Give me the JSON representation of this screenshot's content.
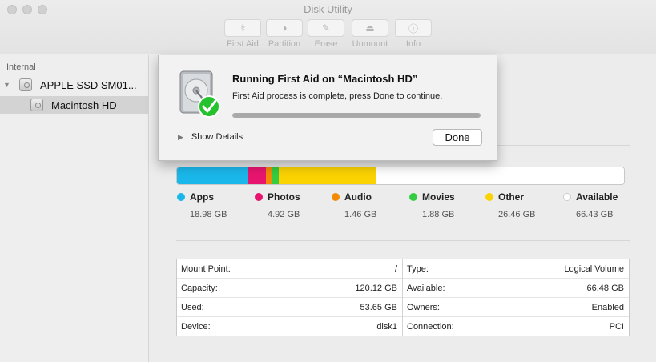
{
  "window": {
    "title": "Disk Utility"
  },
  "toolbar": [
    {
      "label": "First Aid",
      "icon": "stethoscope-icon",
      "glyph": "⚕"
    },
    {
      "label": "Partition",
      "icon": "partition-icon",
      "glyph": "◑"
    },
    {
      "label": "Erase",
      "icon": "erase-icon",
      "glyph": "✎"
    },
    {
      "label": "Unmount",
      "icon": "unmount-icon",
      "glyph": "⏏"
    },
    {
      "label": "Info",
      "icon": "info-icon",
      "glyph": "ⓘ"
    }
  ],
  "sidebar": {
    "section_label": "Internal",
    "disk": {
      "name": "APPLE SSD SM01..."
    },
    "volume": {
      "name": "Macintosh HD"
    }
  },
  "first_aid": {
    "title": "Running First Aid on “Macintosh HD”",
    "message": "First Aid process is complete, press Done to continue.",
    "progress": 1.0,
    "show_details": "Show Details",
    "done": "Done"
  },
  "usage": {
    "capacity_gb": 120.12,
    "categories": [
      {
        "name": "Apps",
        "value": "18.98 GB",
        "gb": 18.98,
        "color": "#1ab7ea"
      },
      {
        "name": "Photos",
        "value": "4.92 GB",
        "gb": 4.92,
        "color": "#e8156f"
      },
      {
        "name": "Audio",
        "value": "1.46 GB",
        "gb": 1.46,
        "color": "#f28a06"
      },
      {
        "name": "Movies",
        "value": "1.88 GB",
        "gb": 1.88,
        "color": "#35cc42"
      },
      {
        "name": "Other",
        "value": "26.46 GB",
        "gb": 26.46,
        "color": "#fbd303"
      },
      {
        "name": "Available",
        "value": "66.43 GB",
        "gb": 66.43,
        "color": "#ffffff"
      }
    ]
  },
  "info": {
    "left": [
      {
        "label": "Mount Point:",
        "value": "/"
      },
      {
        "label": "Capacity:",
        "value": "120.12 GB"
      },
      {
        "label": "Used:",
        "value": "53.65 GB"
      },
      {
        "label": "Device:",
        "value": "disk1"
      }
    ],
    "right": [
      {
        "label": "Type:",
        "value": "Logical Volume"
      },
      {
        "label": "Available:",
        "value": "66.48 GB"
      },
      {
        "label": "Owners:",
        "value": "Enabled"
      },
      {
        "label": "Connection:",
        "value": "PCI"
      }
    ]
  }
}
